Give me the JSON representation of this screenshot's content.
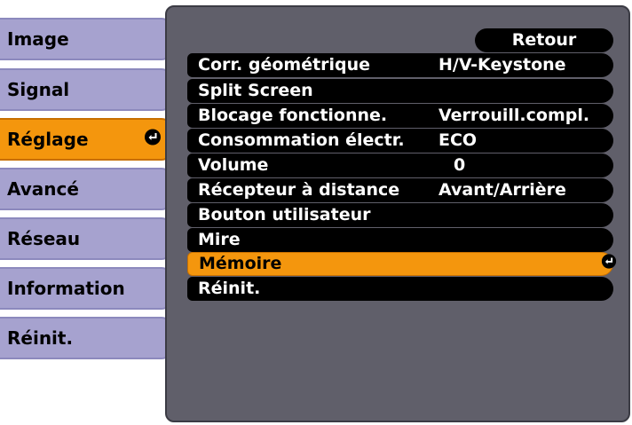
{
  "sidebar": {
    "items": [
      {
        "label": "Image"
      },
      {
        "label": "Signal"
      },
      {
        "label": "Réglage"
      },
      {
        "label": "Avancé"
      },
      {
        "label": "Réseau"
      },
      {
        "label": "Information"
      },
      {
        "label": "Réinit."
      }
    ],
    "active_index": 2
  },
  "panel": {
    "back_label": "Retour",
    "rows": [
      {
        "label": "Corr. géométrique",
        "value": "H/V-Keystone"
      },
      {
        "label": "Split Screen",
        "value": ""
      },
      {
        "label": "Blocage fonctionne.",
        "value": "Verrouill.compl."
      },
      {
        "label": "Consommation électr.",
        "value": "ECO"
      },
      {
        "label": "Volume",
        "value": "0"
      },
      {
        "label": "Récepteur à distance",
        "value": "Avant/Arrière"
      },
      {
        "label": "Bouton utilisateur",
        "value": ""
      },
      {
        "label": "Mire",
        "value": ""
      },
      {
        "label": "Mémoire",
        "value": ""
      },
      {
        "label": "Réinit.",
        "value": ""
      }
    ],
    "selected_index": 8
  },
  "icons": {
    "enter": "enter-icon"
  },
  "colors": {
    "sidebar_bg": "#a6a2cf",
    "highlight": "#f4960d",
    "panel_bg": "#605f6a",
    "row_bg": "#000000",
    "row_text": "#ffffff"
  }
}
